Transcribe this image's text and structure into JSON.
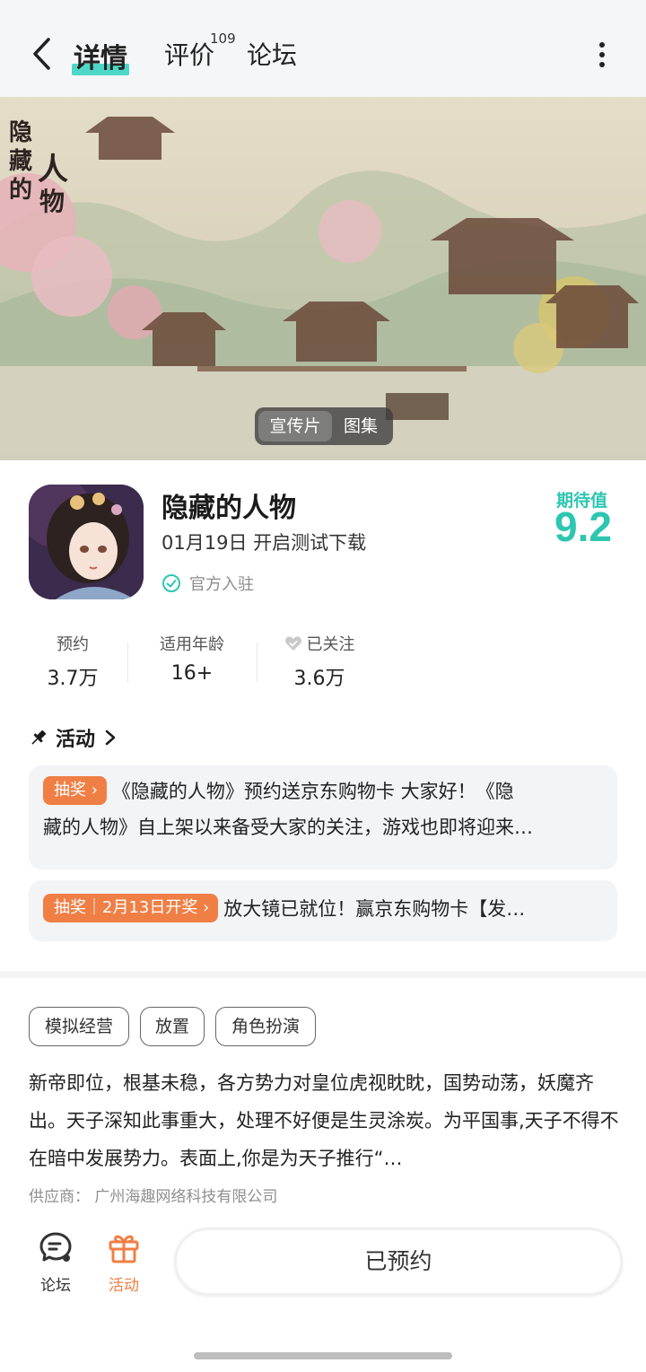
{
  "header": {
    "tabs": [
      "详情",
      "评价",
      "论坛"
    ],
    "review_count": "109",
    "icons": {
      "back": "chevron-left-icon",
      "more": "more-vertical-icon"
    },
    "accent": "#2fd1bd"
  },
  "banner": {
    "art_title": "隐藏的人物",
    "media_tabs": [
      "宣传片",
      "图集"
    ],
    "active_media_tab": "宣传片"
  },
  "game": {
    "title": "隐藏的人物",
    "subtitle": "01月19日 开启测试下载",
    "official": "官方入驻",
    "expect_label": "期待值",
    "expect_score": "9.2",
    "score_color": "#2dc6b0"
  },
  "stats": [
    {
      "label": "预约",
      "value": "3.7万"
    },
    {
      "label": "适用年龄",
      "value": "16+"
    },
    {
      "label": "已关注",
      "value": "3.6万"
    }
  ],
  "activities": {
    "header": "活动",
    "items": [
      {
        "tag": "抽奖",
        "line1": "《隐藏的人物》预约送京东购物卡 大家好！《隐",
        "line2": "藏的人物》自上架以来备受大家的关注，游戏也即将迎来…"
      },
      {
        "tag": "抽奖｜2月13日开奖",
        "line1": "放大镜已就位！赢京东购物卡【发…"
      }
    ],
    "tag_color": "#f07f45"
  },
  "genres": [
    "模拟经营",
    "放置",
    "角色扮演"
  ],
  "description": "新帝即位，根基未稳，各方势力对皇位虎视眈眈，国势动荡，妖魔齐出。天子深知此事重大，处理不好便是生灵涂炭。为平国事,天子不得不在暗中发展势力。表面上,你是为天子推行“…",
  "supplier": "供应商：  广州海趣网络科技有限公司",
  "bottom": {
    "forum_label": "论坛",
    "activity_label": "活动",
    "reserve_label": "已预约",
    "activity_color": "#f07f45"
  }
}
